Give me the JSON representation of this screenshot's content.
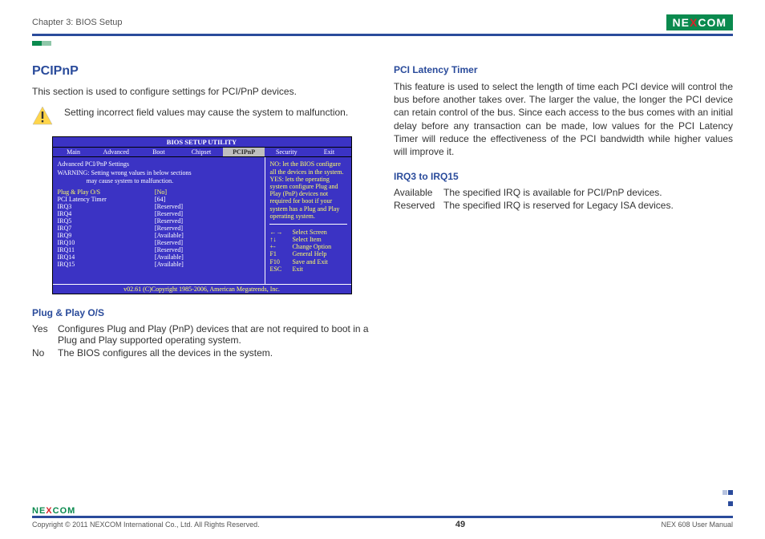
{
  "header": {
    "chapter": "Chapter 3: BIOS Setup",
    "logo_text_pre": "NE",
    "logo_text_x": "X",
    "logo_text_post": "COM"
  },
  "left": {
    "title": "PCIPnP",
    "intro": "This section is used to configure settings for PCI/PnP devices.",
    "warning": "Setting incorrect field values may cause the system to malfunction.",
    "pnp_head": "Plug & Play O/S",
    "pnp_yes_key": "Yes",
    "pnp_yes_val": "Configures Plug and Play (PnP) devices that are not required to boot in a Plug and Play supported operating system.",
    "pnp_no_key": "No",
    "pnp_no_val": "The BIOS configures all the devices in the system."
  },
  "right": {
    "plt_head": "PCI Latency Timer",
    "plt_body": "This feature is used to select the length of time each PCI device will control the bus before another takes over. The larger the value, the longer the PCI device can retain control of the bus. Since each access to the bus comes with an initial delay before any transaction can be made, low values for the PCI Latency Timer will reduce the effectiveness of the PCI bandwidth while higher values will improve it.",
    "irq_head": "IRQ3 to IRQ15",
    "irq_avail_key": "Available",
    "irq_avail_val": "The specified IRQ is available for PCI/PnP devices.",
    "irq_res_key": "Reserved",
    "irq_res_val": "The specified IRQ is reserved for Legacy ISA devices."
  },
  "bios": {
    "title": "BIOS SETUP UTILITY",
    "menu": [
      "Main",
      "Advanced",
      "Boot",
      "Chipset",
      "PCIPnP",
      "Security",
      "Exit"
    ],
    "active_index": 4,
    "section_hdr": "Advanced PCI/PnP Settings",
    "warn1": "WARNING:  Setting wrong values in below sections",
    "warn2": "may cause system to malfunction.",
    "rows": [
      {
        "k": "Plug & Play O/S",
        "v": "[No]",
        "yellow": true
      },
      {
        "k": "PCI Latency Timer",
        "v": "[64]"
      },
      {
        "k": "",
        "v": ""
      },
      {
        "k": "IRQ3",
        "v": "[Reserved]"
      },
      {
        "k": "IRQ4",
        "v": "[Reserved]"
      },
      {
        "k": "IRQ5",
        "v": "[Reserved]"
      },
      {
        "k": "IRQ7",
        "v": "[Reserved]"
      },
      {
        "k": "IRQ9",
        "v": "[Available]"
      },
      {
        "k": "IRQ10",
        "v": "[Reserved]"
      },
      {
        "k": "IRQ11",
        "v": "[Reserved]"
      },
      {
        "k": "IRQ14",
        "v": "[Available]"
      },
      {
        "k": "IRQ15",
        "v": "[Available]"
      }
    ],
    "help_text": "NO: let the BIOS configure all the devices in the system. YES: lets the operating system configure Plug and Play (PnP) devices not required for boot if your system has a Plug and Play operating system.",
    "help_keys": [
      {
        "k": "←→",
        "v": "Select Screen"
      },
      {
        "k": "↑↓",
        "v": "Select Item"
      },
      {
        "k": "+-",
        "v": "Change Option"
      },
      {
        "k": "F1",
        "v": "General Help"
      },
      {
        "k": "F10",
        "v": "Save and Exit"
      },
      {
        "k": "ESC",
        "v": "Exit"
      }
    ],
    "foot": "v02.61 (C)Copyright 1985-2006, American Megatrends, Inc."
  },
  "footer": {
    "copyright": "Copyright © 2011 NEXCOM International Co., Ltd. All Rights Reserved.",
    "page": "49",
    "manual": "NEX 608 User Manual"
  }
}
